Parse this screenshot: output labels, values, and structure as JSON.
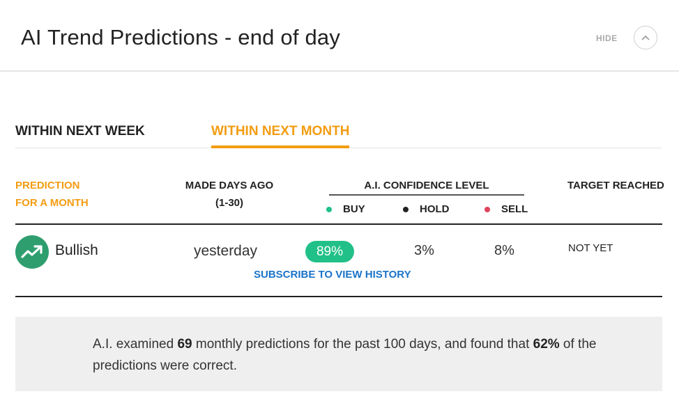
{
  "header": {
    "title": "AI Trend Predictions - end of day",
    "hide_label": "HIDE",
    "collapse_icon": "chevron-up-icon"
  },
  "tabs": [
    {
      "label": "WITHIN NEXT WEEK",
      "active": false
    },
    {
      "label": "WITHIN NEXT MONTH",
      "active": true
    }
  ],
  "table": {
    "headers": {
      "prediction_line1": "PREDICTION",
      "prediction_line2": "FOR A MONTH",
      "days_line1": "MADE DAYS AGO",
      "days_line2": "(1-30)",
      "confidence": "A.I. CONFIDENCE LEVEL",
      "target": "TARGET REACHED"
    },
    "legend": [
      {
        "label": "BUY",
        "color": "#21c089"
      },
      {
        "label": "HOLD",
        "color": "#222222"
      },
      {
        "label": "SELL",
        "color": "#e0435b"
      }
    ],
    "row": {
      "icon": "trend-up-icon",
      "prediction": "Bullish",
      "made": "yesterday",
      "buy": "89%",
      "hold": "3%",
      "sell": "8%",
      "target": "NOT YET"
    },
    "subscribe_label": "SUBSCRIBE TO VIEW HISTORY"
  },
  "summary": {
    "part1": "A.I. examined ",
    "count": "69",
    "part2": " monthly predictions for the past 100 days, and found that ",
    "pct": "62%",
    "part3": " of the predictions were correct."
  },
  "colors": {
    "accent": "#f39c12",
    "buy": "#21c089",
    "link": "#1a73c8",
    "icon_bg": "#2e9e6f"
  }
}
